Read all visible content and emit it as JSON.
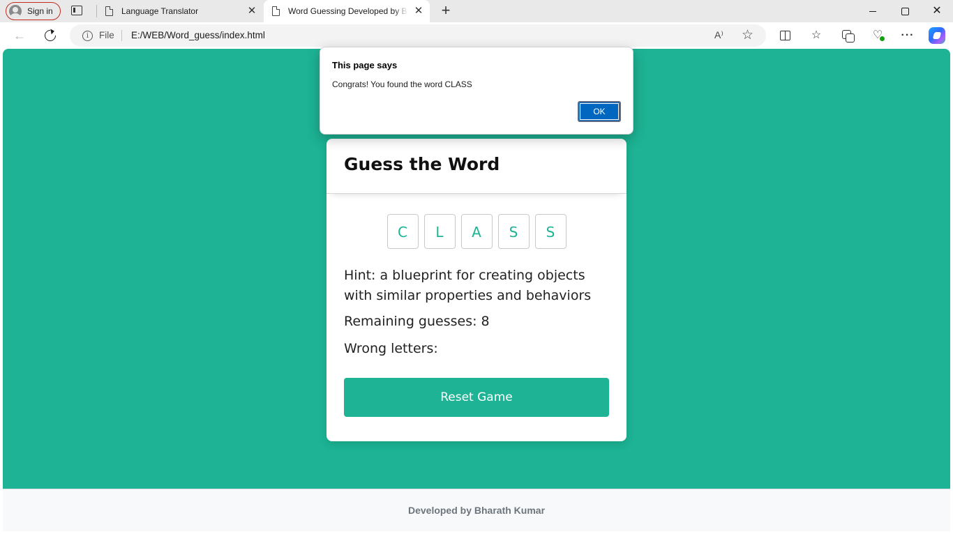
{
  "browser": {
    "signin_label": "Sign in",
    "tabs": [
      {
        "title": "Language Translator",
        "active": false
      },
      {
        "title": "Word Guessing Developed by Bharath Kumar",
        "active": true
      }
    ],
    "address": {
      "scheme_label": "File",
      "url": "E:/WEB/Word_guess/index.html"
    },
    "readaloud_label": "A⁾"
  },
  "game": {
    "title": "Guess the Word",
    "letters": [
      "C",
      "L",
      "A",
      "S",
      "S"
    ],
    "hint": "Hint: a blueprint for creating objects with similar properties and behaviors",
    "remaining": "Remaining guesses: 8",
    "wrong": "Wrong letters:",
    "reset_label": "Reset Game",
    "accent_color": "#1db394"
  },
  "footer": {
    "text": "Developed by Bharath Kumar"
  },
  "alert": {
    "title": "This page says",
    "message": "Congrats! You found the word CLASS",
    "ok_label": "OK"
  }
}
